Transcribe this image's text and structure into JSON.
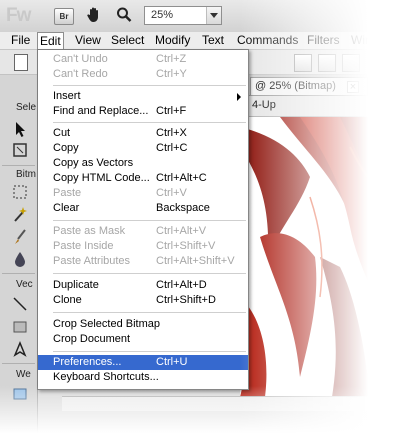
{
  "app": {
    "logo": "Fw",
    "bridge_label": "Br",
    "zoom_value": "25%"
  },
  "menubar": {
    "items": [
      "File",
      "Edit",
      "View",
      "Select",
      "Modify",
      "Text",
      "Commands",
      "Filters",
      "Windo"
    ]
  },
  "tools_panel": {
    "sections": [
      "Sele",
      "Bitm",
      "Vec",
      "We"
    ]
  },
  "document": {
    "tab_title": "@ 25% (Bitmap)",
    "tab_close": "×",
    "view_label": "4-Up"
  },
  "edit_menu": {
    "undo": {
      "label": "Can't Undo",
      "shortcut": "Ctrl+Z"
    },
    "redo": {
      "label": "Can't Redo",
      "shortcut": "Ctrl+Y"
    },
    "insert": {
      "label": "Insert"
    },
    "find_replace": {
      "label": "Find and Replace...",
      "shortcut": "Ctrl+F"
    },
    "cut": {
      "label": "Cut",
      "shortcut": "Ctrl+X"
    },
    "copy": {
      "label": "Copy",
      "shortcut": "Ctrl+C"
    },
    "copy_vectors": {
      "label": "Copy as Vectors"
    },
    "copy_html": {
      "label": "Copy HTML Code...",
      "shortcut": "Ctrl+Alt+C"
    },
    "paste": {
      "label": "Paste",
      "shortcut": "Ctrl+V"
    },
    "clear": {
      "label": "Clear",
      "shortcut": "Backspace"
    },
    "paste_mask": {
      "label": "Paste as Mask",
      "shortcut": "Ctrl+Alt+V"
    },
    "paste_inside": {
      "label": "Paste Inside",
      "shortcut": "Ctrl+Shift+V"
    },
    "paste_attributes": {
      "label": "Paste Attributes",
      "shortcut": "Ctrl+Alt+Shift+V"
    },
    "duplicate": {
      "label": "Duplicate",
      "shortcut": "Ctrl+Alt+D"
    },
    "clone": {
      "label": "Clone",
      "shortcut": "Ctrl+Shift+D"
    },
    "crop_bitmap": {
      "label": "Crop Selected Bitmap"
    },
    "crop_document": {
      "label": "Crop Document"
    },
    "preferences": {
      "label": "Preferences...",
      "shortcut": "Ctrl+U"
    },
    "keyboard_shortcuts": {
      "label": "Keyboard Shortcuts..."
    }
  },
  "colors": {
    "highlight": "#3669cf",
    "disabled_text": "#a6a6a6",
    "hair": "#b0140a"
  }
}
